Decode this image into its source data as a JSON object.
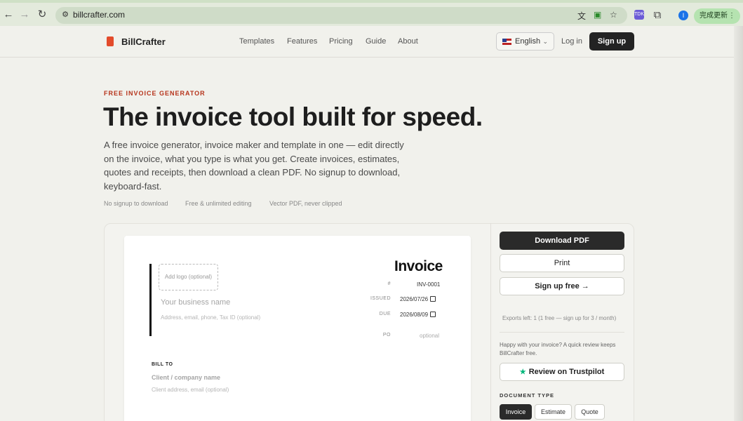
{
  "browser": {
    "url": "billcrafter.com",
    "profile_initial": "I",
    "update_label": "完成更新",
    "ext_label": "TDK"
  },
  "header": {
    "brand": "BillCrafter",
    "nav": [
      "Templates",
      "Features",
      "Pricing",
      "Guide",
      "About"
    ],
    "language": "English",
    "login": "Log in",
    "signup": "Sign up"
  },
  "hero": {
    "eyebrow": "FREE INVOICE GENERATOR",
    "title": "The invoice tool built for speed.",
    "description": "A free invoice generator, invoice maker and template in one — edit directly on the invoice, what you type is what you get. Create invoices, estimates, quotes and receipts, then download a clean PDF. No signup to download, keyboard-fast.",
    "features": [
      "No signup to download",
      "Free & unlimited editing",
      "Vector PDF, never clipped"
    ]
  },
  "invoice": {
    "logo_placeholder": "Add logo (optional)",
    "business_name_placeholder": "Your business name",
    "business_details_placeholder": "Address, email, phone, Tax ID (optional)",
    "title": "Invoice",
    "number_label": "#",
    "number_value": "INV-0001",
    "issued_label": "ISSUED",
    "issued_value": "2026/07/26",
    "due_label": "DUE",
    "due_value": "2026/08/09",
    "po_label": "PO",
    "po_placeholder": "optional",
    "bill_to_label": "BILL TO",
    "client_name_placeholder": "Client / company name",
    "client_details_placeholder": "Client address, email (optional)"
  },
  "panel": {
    "download": "Download PDF",
    "print": "Print",
    "signup_free": "Sign up free →",
    "exports_left": "Exports left: 1 (1 free — sign up for 3 / month)",
    "review_prompt": "Happy with your invoice? A quick review keeps BillCrafter free.",
    "review_button": "Review on Trustpilot",
    "doc_type_label": "DOCUMENT TYPE",
    "doc_types": [
      "Invoice",
      "Estimate",
      "Quote"
    ],
    "doc_type_selected": "Invoice"
  },
  "colors": {
    "accent": "#b6341b",
    "brand_icon": "#e34b2b",
    "primary_button": "#2a2a2a",
    "trustpilot_star": "#00b67a"
  },
  "icons": [
    "back-icon",
    "forward-icon",
    "reload-icon",
    "site-info-icon",
    "translate-icon",
    "install-icon",
    "bookmark-star-icon",
    "extension-icon",
    "puzzle-icon",
    "menu-dots-icon",
    "brand-icon",
    "us-flag-icon",
    "chevron-down-icon",
    "calendar-icon",
    "trustpilot-star-icon"
  ]
}
